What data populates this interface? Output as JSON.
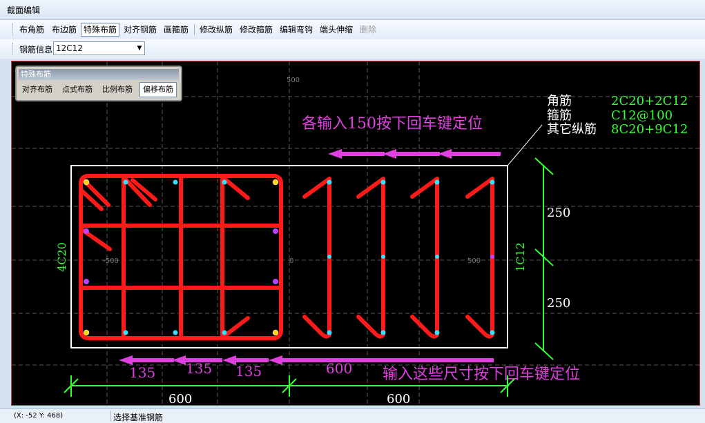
{
  "window": {
    "title": "截面编辑"
  },
  "toolbar1": {
    "buttons": [
      "布角筋",
      "布边筋",
      "特殊布筋",
      "对齐钢筋",
      "画箍筋",
      "修改纵筋",
      "修改箍筋",
      "编辑弯钩",
      "端头伸缩",
      "删除"
    ]
  },
  "toolbar2": {
    "label": "钢筋信息",
    "value": "12C12"
  },
  "panel": {
    "title": "特殊布筋",
    "buttons": [
      "对齐布筋",
      "点式布筋",
      "比例布筋",
      "偏移布筋"
    ]
  },
  "drawing": {
    "legend": [
      {
        "key": "角筋",
        "value": "2C20+2C12"
      },
      {
        "key": "箍筋",
        "value": "C12@100"
      },
      {
        "key": "其它纵筋",
        "value": "8C20+9C12"
      }
    ],
    "annotation_top": "各输入150按下回车键定位",
    "annotation_bottom": "输入这些尺寸按下回车键定位",
    "left_dim_label": "4C20",
    "right_dim_label": "1C12",
    "dim_right": [
      "250",
      "250"
    ],
    "dim_spacing": [
      "135",
      "135",
      "135",
      "600"
    ],
    "dim_bottom": [
      "600",
      "600"
    ],
    "grid_labels": {
      "top": "500",
      "left": "-500",
      "center": "0",
      "right": "500"
    },
    "colors": {
      "rebar": "#ff1a1a",
      "dimension": "#33ff33",
      "annotation": "#e040e0",
      "outline": "#ffffff",
      "text": "#ffffff"
    }
  },
  "status": {
    "coords": "(X: -52 Y: 468)",
    "message": "选择基准钢筋"
  }
}
